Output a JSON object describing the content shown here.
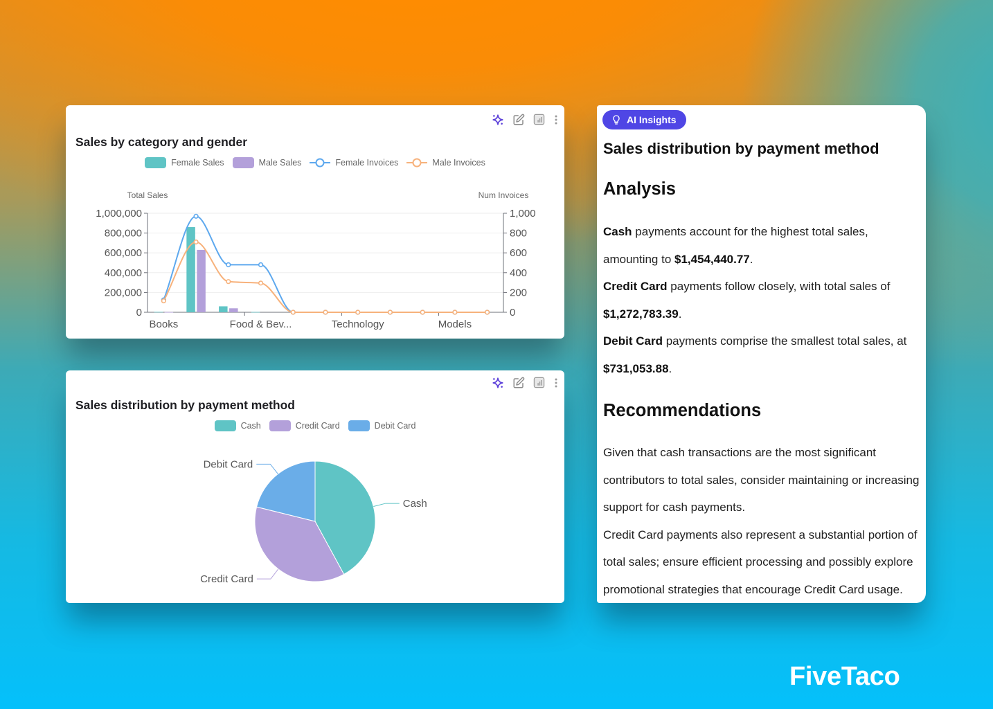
{
  "category_card": {
    "title": "Sales by category and gender",
    "toolbar": [
      {
        "icon": "sparkle-icon",
        "label": "AI insights"
      },
      {
        "icon": "pencil-icon",
        "label": "Edit"
      },
      {
        "icon": "chart-icon",
        "label": "Chart type"
      },
      {
        "icon": "more-vertical-icon",
        "label": "More"
      }
    ]
  },
  "payment_card": {
    "title": "Sales distribution by payment method",
    "toolbar": [
      {
        "icon": "sparkle-icon",
        "label": "AI insights"
      },
      {
        "icon": "pencil-icon",
        "label": "Edit"
      },
      {
        "icon": "chart-icon",
        "label": "Chart type"
      },
      {
        "icon": "more-vertical-icon",
        "label": "More"
      }
    ]
  },
  "insights": {
    "badge_label": "AI Insights",
    "badge_icon": "lightbulb-icon",
    "accent_color": "#4f46e5",
    "title": "Sales distribution by payment method",
    "analysis_heading": "Analysis",
    "analysis_lines": [
      [
        {
          "text": "Cash",
          "bold": true
        },
        {
          "text": " payments account for the highest total sales,"
        }
      ],
      [
        {
          "text": "amounting to "
        },
        {
          "text": "$1,454,440.77",
          "bold": true
        },
        {
          "text": "."
        }
      ],
      [
        {
          "text": "Credit Card",
          "bold": true
        },
        {
          "text": " payments follow closely, with total sales of"
        }
      ],
      [
        {
          "text": "$1,272,783.39",
          "bold": true
        },
        {
          "text": "."
        }
      ],
      [
        {
          "text": "Debit Card",
          "bold": true
        },
        {
          "text": " payments comprise the smallest total sales, at"
        }
      ],
      [
        {
          "text": "$731,053.88",
          "bold": true
        },
        {
          "text": "."
        }
      ]
    ],
    "recommendations_heading": "Recommendations",
    "recommendations_lines": [
      [
        {
          "text": "Given that cash transactions are the most significant"
        }
      ],
      [
        {
          "text": "contributors to total sales, consider maintaining or increasing"
        }
      ],
      [
        {
          "text": "support for cash payments."
        }
      ],
      [
        {
          "text": "Credit Card payments also represent a substantial portion of"
        }
      ],
      [
        {
          "text": "total sales; ensure efficient processing and possibly explore"
        }
      ],
      [
        {
          "text": "promotional strategies that encourage Credit Card usage."
        }
      ]
    ]
  },
  "brand": {
    "logo_text": "FiveTaco"
  },
  "chart_data": [
    {
      "type": "bar",
      "title": "Sales by category and gender",
      "categories": [
        "Books",
        "",
        "",
        "Food & Bev...",
        "",
        "",
        "Technology",
        "",
        "",
        "Models",
        ""
      ],
      "xlabel": "",
      "ylabel": "Total Sales",
      "y2label": "Num Invoices",
      "ylim": [
        0,
        1000000
      ],
      "y2lim": [
        0,
        1000
      ],
      "yticks": [
        0,
        200000,
        400000,
        600000,
        800000,
        1000000
      ],
      "ytick_labels": [
        "0",
        "200,000",
        "400,000",
        "600,000",
        "800,000",
        "1,000,000"
      ],
      "y2ticks": [
        0,
        200,
        400,
        600,
        800,
        1000
      ],
      "y2tick_labels": [
        "0",
        "200",
        "400",
        "600",
        "800",
        "1,000"
      ],
      "grid": true,
      "legend_position": "top-center",
      "series": [
        {
          "name": "Female Sales",
          "type": "bar",
          "axis": "left",
          "color": "#5fc4c5",
          "values": [
            4000,
            860000,
            60000,
            3000,
            0,
            0,
            0,
            0,
            0,
            0,
            0
          ]
        },
        {
          "name": "Male Sales",
          "type": "bar",
          "axis": "left",
          "color": "#b3a0da",
          "values": [
            2000,
            630000,
            40000,
            0,
            0,
            0,
            0,
            0,
            0,
            0,
            0
          ]
        },
        {
          "name": "Female Invoices",
          "type": "line",
          "smooth": true,
          "axis": "right",
          "color": "#5da8ee",
          "values": [
            125,
            970,
            480,
            480,
            0,
            0,
            0,
            0,
            0,
            0,
            0
          ]
        },
        {
          "name": "Male Invoices",
          "type": "line",
          "smooth": true,
          "axis": "right",
          "color": "#f7b27c",
          "values": [
            115,
            710,
            310,
            295,
            0,
            0,
            0,
            0,
            0,
            0,
            0
          ]
        }
      ]
    },
    {
      "type": "pie",
      "title": "Sales distribution by payment method",
      "legend_position": "top-center",
      "slices": [
        {
          "label": "Cash",
          "value": 1454440.77,
          "color": "#5fc4c5"
        },
        {
          "label": "Credit Card",
          "value": 1272783.39,
          "color": "#b3a0da"
        },
        {
          "label": "Debit Card",
          "value": 731053.88,
          "color": "#6aade8"
        }
      ]
    }
  ]
}
